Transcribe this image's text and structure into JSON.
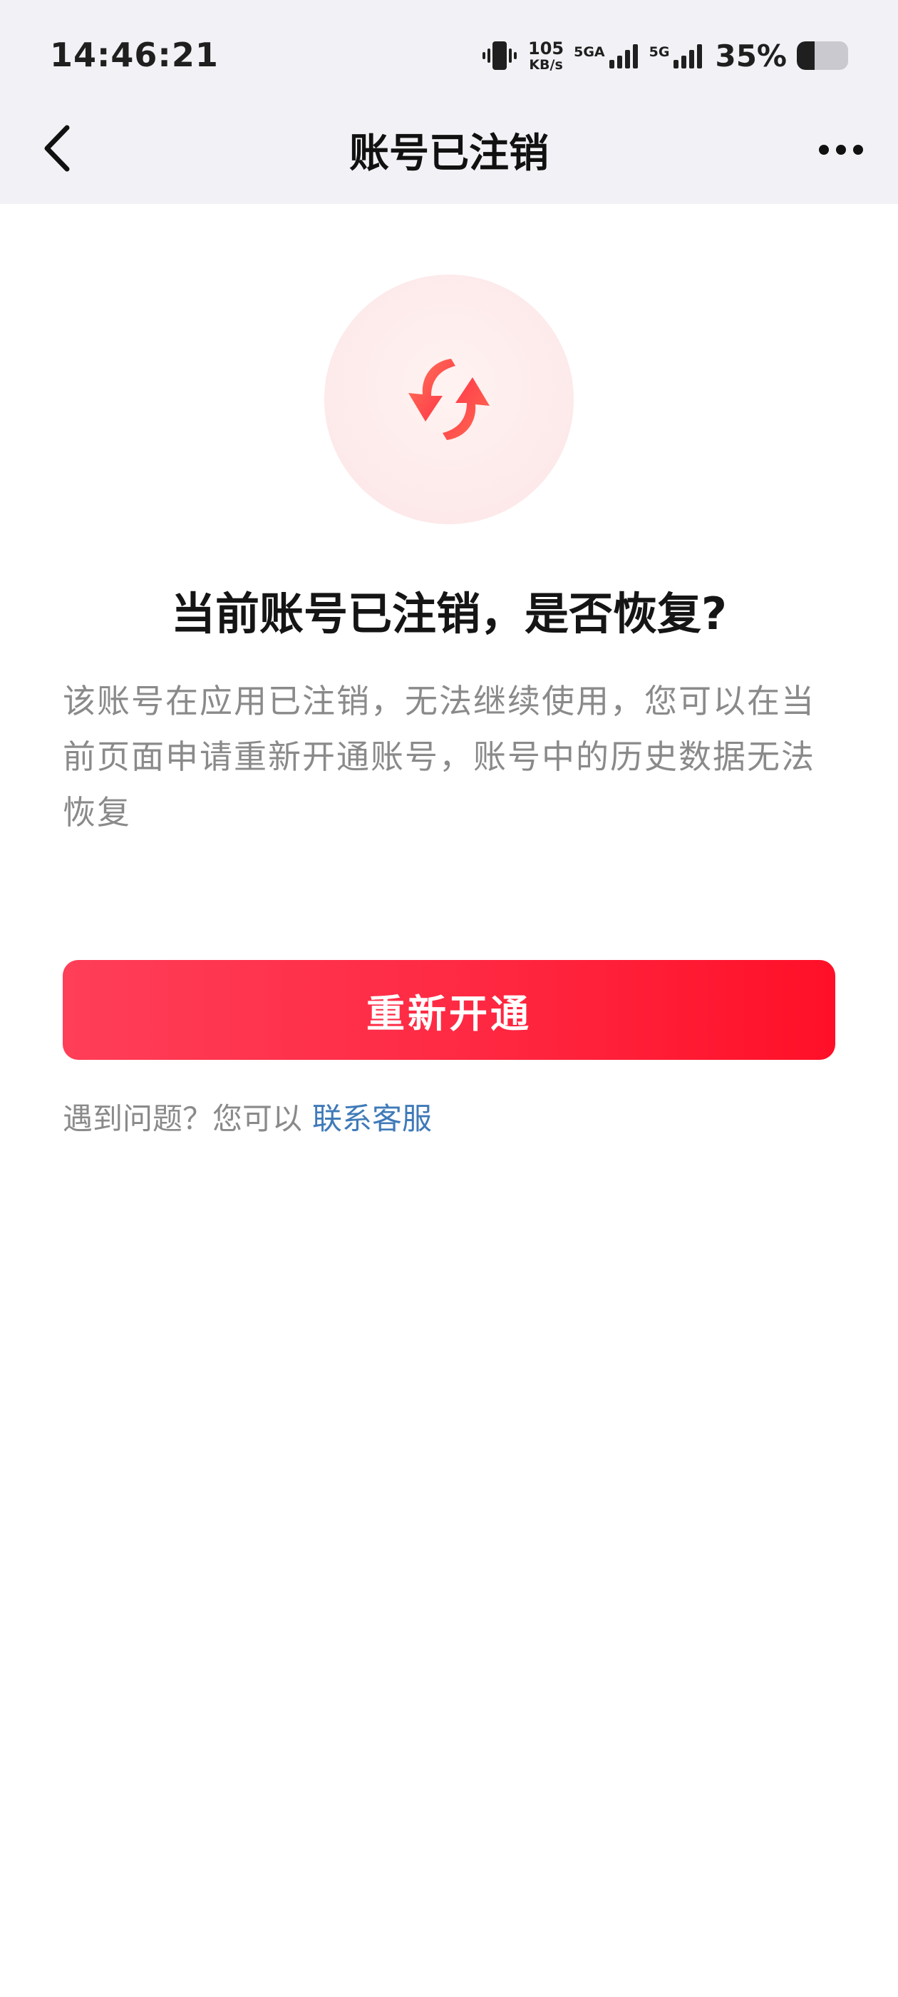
{
  "status_bar": {
    "time": "14:46:21",
    "net_speed_value": "105",
    "net_speed_unit": "KB/s",
    "sim1_label": "5GA",
    "sim2_label": "5G",
    "battery_percent": "35%",
    "battery_level": 0.35,
    "icons": [
      "vibrate-icon",
      "signal-icon",
      "battery-icon"
    ]
  },
  "nav": {
    "title": "账号已注销",
    "back_icon": "chevron-left-icon",
    "more_icon": "more-horizontal-icon"
  },
  "hero": {
    "icon": "refresh-arrows-icon",
    "accent_color": "#ff3b4f"
  },
  "content": {
    "headline": "当前账号已注销，是否恢复?",
    "description": "该账号在应用已注销，无法继续使用，您可以在当前页面申请重新开通账号，账号中的历史数据无法恢复",
    "primary_button": "重新开通",
    "help_prefix": "遇到问题？您可以",
    "help_link": "联系客服",
    "link_color": "#3f7ab8"
  }
}
